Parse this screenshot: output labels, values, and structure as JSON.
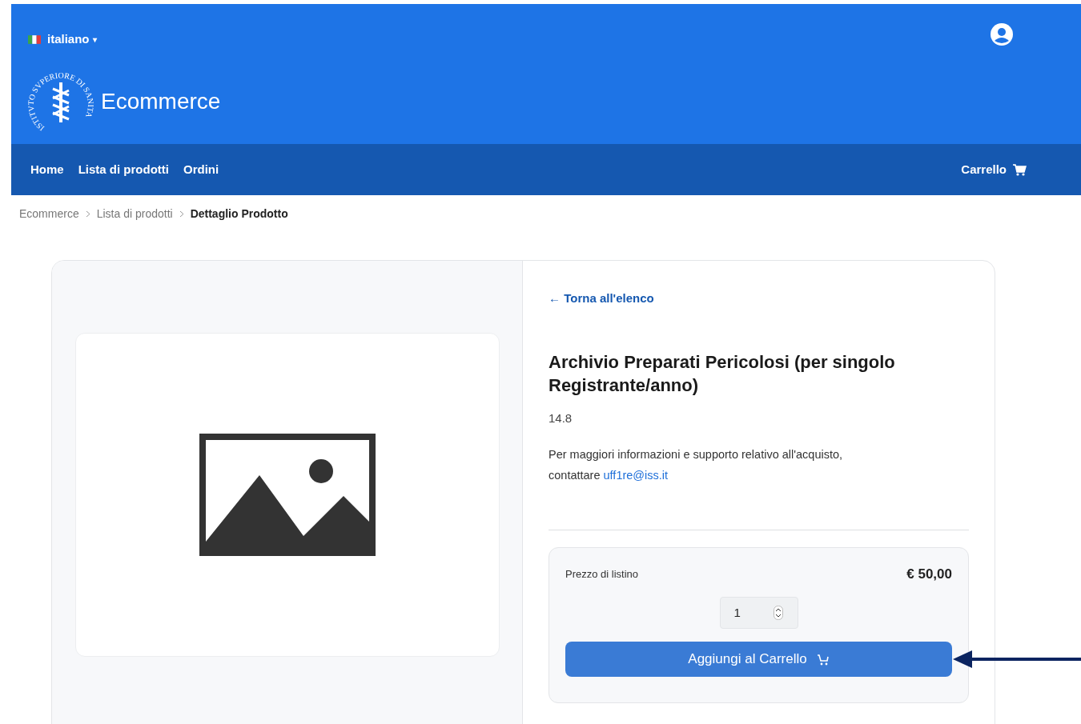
{
  "header": {
    "language": {
      "label": "italiano",
      "caret": "▾"
    },
    "logo_text": "ISTITVTO SVPERIORE DI SANITA",
    "site_title": "Ecommerce"
  },
  "nav": {
    "items": [
      {
        "label": "Home"
      },
      {
        "label": "Lista di prodotti"
      },
      {
        "label": "Ordini"
      }
    ],
    "cart": "Carrello"
  },
  "breadcrumb": [
    {
      "label": "Ecommerce",
      "current": false
    },
    {
      "label": "Lista di prodotti",
      "current": false
    },
    {
      "label": "Dettaglio Prodotto",
      "current": true
    }
  ],
  "product": {
    "back_link": "← Torna all'elenco",
    "title": "Archivio Preparati Pericolosi (per singolo Registrante/anno)",
    "code": "14.8",
    "info": "Per maggiori informazioni e supporto relativo all'acquisto, contattare",
    "email": "uff1re@iss.it",
    "price_label": "Prezzo di listino",
    "price": "€ 50,00",
    "quantity": "1",
    "add_button": "Aggiungi al Carrello"
  },
  "annotation": {
    "kind": "arrow"
  }
}
